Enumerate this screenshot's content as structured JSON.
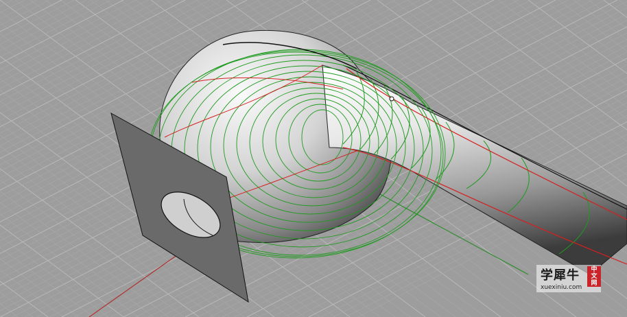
{
  "viewport": {
    "colors": {
      "background": "#9d9d9d",
      "grid_minor": "#a9a9a9",
      "grid_major": "#b9b9b9",
      "x_axis": "#b03030",
      "y_axis": "#2e8b2e",
      "isocurve_green": "#1f9a1f",
      "isocurve_red": "#d42020",
      "edge_black": "#111111",
      "plane_fill": "#6a6a6a"
    },
    "objects": [
      "grid",
      "x-axis",
      "y-axis",
      "pipe-surface",
      "bulb-surface",
      "cutting-plane",
      "ellipse-hole"
    ]
  },
  "watermark": {
    "cn_text": "学犀牛",
    "badge_chars": [
      "中",
      "文",
      "网"
    ],
    "url": "xuexiniu.com"
  }
}
